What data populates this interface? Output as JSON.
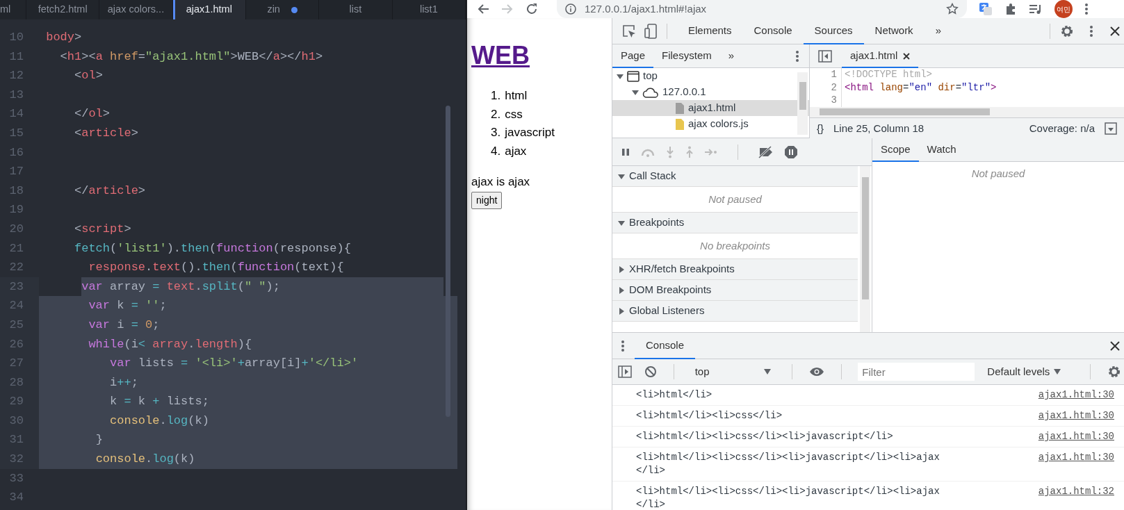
{
  "editor": {
    "tabs": [
      {
        "label": "ml",
        "selected": false,
        "modified": false
      },
      {
        "label": "fetch2.html",
        "selected": false,
        "modified": false
      },
      {
        "label": "ajax colors...",
        "selected": false,
        "modified": false
      },
      {
        "label": "ajax1.html",
        "selected": true,
        "modified": false
      },
      {
        "label": "zin",
        "selected": false,
        "modified": true
      },
      {
        "label": "list",
        "selected": false,
        "modified": false
      },
      {
        "label": "list1",
        "selected": false,
        "modified": false
      }
    ],
    "lines": [
      {
        "number": "10",
        "selected": false,
        "tokens": [
          {
            "text": " body",
            "kind": "tag"
          },
          {
            "text": ">",
            "kind": "plain"
          }
        ]
      },
      {
        "number": "11",
        "selected": false,
        "tokens": [
          {
            "text": "   <",
            "kind": "plain"
          },
          {
            "text": "h1",
            "kind": "tag"
          },
          {
            "text": "><",
            "kind": "plain"
          },
          {
            "text": "a",
            "kind": "tag"
          },
          {
            "text": " href",
            "kind": "attr"
          },
          {
            "text": "=",
            "kind": "plain"
          },
          {
            "text": "\"ajax1.html\"",
            "kind": "str"
          },
          {
            "text": ">WEB</",
            "kind": "plain"
          },
          {
            "text": "a",
            "kind": "tag"
          },
          {
            "text": "></",
            "kind": "plain"
          },
          {
            "text": "h1",
            "kind": "tag"
          },
          {
            "text": ">",
            "kind": "plain"
          }
        ]
      },
      {
        "number": "12",
        "selected": false,
        "tokens": [
          {
            "text": "     <",
            "kind": "plain"
          },
          {
            "text": "ol",
            "kind": "tag"
          },
          {
            "text": ">",
            "kind": "plain"
          }
        ]
      },
      {
        "number": "13",
        "selected": false
      },
      {
        "number": "14",
        "selected": false,
        "tokens": [
          {
            "text": "     </",
            "kind": "plain"
          },
          {
            "text": "ol",
            "kind": "tag"
          },
          {
            "text": ">",
            "kind": "plain"
          }
        ]
      },
      {
        "number": "15",
        "selected": false,
        "tokens": [
          {
            "text": "     <",
            "kind": "plain"
          },
          {
            "text": "article",
            "kind": "tag"
          },
          {
            "text": ">",
            "kind": "plain"
          }
        ]
      },
      {
        "number": "16",
        "selected": false
      },
      {
        "number": "17",
        "selected": false
      },
      {
        "number": "18",
        "selected": false,
        "tokens": [
          {
            "text": "     </",
            "kind": "plain"
          },
          {
            "text": "article",
            "kind": "tag"
          },
          {
            "text": ">",
            "kind": "plain"
          }
        ]
      },
      {
        "number": "19",
        "selected": false
      },
      {
        "number": "20",
        "selected": false,
        "tokens": [
          {
            "text": "     <",
            "kind": "plain"
          },
          {
            "text": "script",
            "kind": "tag"
          },
          {
            "text": ">",
            "kind": "plain"
          }
        ]
      },
      {
        "number": "21",
        "selected": false,
        "tokens": [
          {
            "text": "     fetch",
            "kind": "fn"
          },
          {
            "text": "(",
            "kind": "plain"
          },
          {
            "text": "'list1'",
            "kind": "str"
          },
          {
            "text": ").",
            "kind": "plain"
          },
          {
            "text": "then",
            "kind": "fn"
          },
          {
            "text": "(",
            "kind": "plain"
          },
          {
            "text": "function",
            "kind": "kw"
          },
          {
            "text": "(response){",
            "kind": "plain"
          }
        ]
      },
      {
        "number": "22",
        "selected": false,
        "tokens": [
          {
            "text": "       response",
            "kind": "var"
          },
          {
            "text": ".",
            "kind": "plain"
          },
          {
            "text": "text",
            "kind": "var"
          },
          {
            "text": "().",
            "kind": "plain"
          },
          {
            "text": "then",
            "kind": "fn"
          },
          {
            "text": "(",
            "kind": "plain"
          },
          {
            "text": "function",
            "kind": "kw"
          },
          {
            "text": "(text){",
            "kind": "plain"
          }
        ]
      },
      {
        "number": "23",
        "selected": true,
        "selection_from_text": true,
        "tokens": [
          {
            "text": "      var",
            "kind": "kw"
          },
          {
            "text": " array ",
            "kind": "plain"
          },
          {
            "text": "=",
            "kind": "op"
          },
          {
            "text": " text",
            "kind": "var"
          },
          {
            "text": ".",
            "kind": "plain"
          },
          {
            "text": "split",
            "kind": "fn"
          },
          {
            "text": "(",
            "kind": "plain"
          },
          {
            "text": "\" \"",
            "kind": "str"
          },
          {
            "text": ");",
            "kind": "plain"
          }
        ]
      },
      {
        "number": "24",
        "selected": true,
        "tokens": [
          {
            "text": "       var",
            "kind": "kw"
          },
          {
            "text": " k ",
            "kind": "plain"
          },
          {
            "text": "=",
            "kind": "op"
          },
          {
            "text": " ''",
            "kind": "str"
          },
          {
            "text": ";",
            "kind": "plain"
          }
        ]
      },
      {
        "number": "25",
        "selected": true,
        "tokens": [
          {
            "text": "       var",
            "kind": "kw"
          },
          {
            "text": " i ",
            "kind": "plain"
          },
          {
            "text": "=",
            "kind": "op"
          },
          {
            "text": " 0",
            "kind": "num"
          },
          {
            "text": ";",
            "kind": "plain"
          }
        ]
      },
      {
        "number": "26",
        "selected": true,
        "tokens": [
          {
            "text": "       while",
            "kind": "kw"
          },
          {
            "text": "(i",
            "kind": "plain"
          },
          {
            "text": "<",
            "kind": "op"
          },
          {
            "text": " array",
            "kind": "var"
          },
          {
            "text": ".",
            "kind": "plain"
          },
          {
            "text": "length",
            "kind": "var"
          },
          {
            "text": "){",
            "kind": "plain"
          }
        ]
      },
      {
        "number": "27",
        "selected": true,
        "tokens": [
          {
            "text": "          var",
            "kind": "kw"
          },
          {
            "text": " lists ",
            "kind": "plain"
          },
          {
            "text": "=",
            "kind": "op"
          },
          {
            "text": " '<li>'",
            "kind": "str"
          },
          {
            "text": "+",
            "kind": "op"
          },
          {
            "text": "array[i]",
            "kind": "plain"
          },
          {
            "text": "+",
            "kind": "op"
          },
          {
            "text": "'</li>'",
            "kind": "str"
          }
        ]
      },
      {
        "number": "28",
        "selected": true,
        "tokens": [
          {
            "text": "          i",
            "kind": "plain"
          },
          {
            "text": "++",
            "kind": "op"
          },
          {
            "text": ";",
            "kind": "plain"
          }
        ]
      },
      {
        "number": "29",
        "selected": true,
        "tokens": [
          {
            "text": "          k ",
            "kind": "plain"
          },
          {
            "text": "=",
            "kind": "op"
          },
          {
            "text": " k ",
            "kind": "plain"
          },
          {
            "text": "+",
            "kind": "op"
          },
          {
            "text": " lists;",
            "kind": "plain"
          }
        ]
      },
      {
        "number": "30",
        "selected": true,
        "tokens": [
          {
            "text": "          console",
            "kind": "obj"
          },
          {
            "text": ".",
            "kind": "plain"
          },
          {
            "text": "log",
            "kind": "fn"
          },
          {
            "text": "(k)",
            "kind": "plain"
          }
        ]
      },
      {
        "number": "31",
        "selected": true,
        "tokens": [
          {
            "text": "        }",
            "kind": "plain"
          }
        ]
      },
      {
        "number": "32",
        "selected": true,
        "tokens": [
          {
            "text": "        console",
            "kind": "obj"
          },
          {
            "text": ".",
            "kind": "plain"
          },
          {
            "text": "log",
            "kind": "fn"
          },
          {
            "text": "(k)",
            "kind": "plain"
          }
        ]
      },
      {
        "number": "33",
        "selected": false
      },
      {
        "number": "34",
        "selected": false
      }
    ]
  },
  "browser": {
    "url": "127.0.0.1/ajax1.html#!ajax",
    "profile": "여민",
    "page": {
      "heading": "WEB",
      "list": [
        {
          "number": "1.",
          "label": "html"
        },
        {
          "number": "2.",
          "label": "css"
        },
        {
          "number": "3.",
          "label": "javascript"
        },
        {
          "number": "4.",
          "label": "ajax"
        }
      ],
      "paragraph": "ajax is ajax",
      "button": "night"
    }
  },
  "devtools": {
    "tabs": [
      {
        "label": "Elements",
        "selected": false
      },
      {
        "label": "Console",
        "selected": false
      },
      {
        "label": "Sources",
        "selected": true
      },
      {
        "label": "Network",
        "selected": false
      }
    ],
    "more": "»",
    "navigator": {
      "tabs": [
        {
          "label": "Page",
          "selected": true
        },
        {
          "label": "Filesystem",
          "selected": false
        }
      ],
      "more": "»",
      "tree": [
        {
          "label": "top",
          "kind": "frame",
          "expanded": true,
          "children": [
            {
              "label": "127.0.0.1",
              "kind": "domain",
              "expanded": true,
              "children": [
                {
                  "label": "ajax1.html",
                  "kind": "html",
                  "selected": true
                },
                {
                  "label": "ajax colors.js",
                  "kind": "js",
                  "selected": false
                }
              ]
            }
          ]
        }
      ]
    },
    "source": {
      "tabs": [
        {
          "label": "ajax1.html",
          "selected": true
        }
      ],
      "lines": [
        {
          "number": "1",
          "tokens": [
            {
              "text": "<!DOCTYPE html>",
              "kind": "dt"
            }
          ]
        },
        {
          "number": "2",
          "tokens": [
            {
              "text": "<html",
              "kind": "stag"
            },
            {
              "text": " lang",
              "kind": "sattr"
            },
            {
              "text": "=",
              "kind": "sp"
            },
            {
              "text": "\"en\"",
              "kind": "sval"
            },
            {
              "text": " dir",
              "kind": "sattr"
            },
            {
              "text": "=",
              "kind": "sp"
            },
            {
              "text": "\"ltr\"",
              "kind": "sval"
            },
            {
              "text": ">",
              "kind": "stag"
            }
          ]
        },
        {
          "number": "3"
        }
      ],
      "format": "{}",
      "status": "Line 25, Column 18",
      "coverage": "Coverage: n/a"
    },
    "debugger": {
      "sections": [
        {
          "title": "Call Stack",
          "expanded": true,
          "message": "Not paused"
        },
        {
          "title": "Breakpoints",
          "expanded": true,
          "message": "No breakpoints"
        },
        {
          "title": "XHR/fetch Breakpoints",
          "expanded": false
        },
        {
          "title": "DOM Breakpoints",
          "expanded": false
        },
        {
          "title": "Global Listeners",
          "expanded": false
        }
      ],
      "side_tabs": [
        {
          "label": "Scope",
          "selected": true
        },
        {
          "label": "Watch",
          "selected": false
        }
      ],
      "side_message": "Not paused"
    },
    "console": {
      "drawer_tabs": [
        {
          "label": "Console",
          "selected": true
        }
      ],
      "context": "top",
      "filter": {
        "placeholder": "Filter"
      },
      "levels": "Default levels",
      "messages": [
        {
          "text": "<li>html</li>",
          "source": "ajax1.html:30"
        },
        {
          "text": "<li>html</li><li>css</li>",
          "source": "ajax1.html:30"
        },
        {
          "text": "<li>html</li><li>css</li><li>javascript</li>",
          "source": "ajax1.html:30"
        },
        {
          "text": "<li>html</li><li>css</li><li>javascript</li><li>ajax</li>",
          "source": "ajax1.html:30"
        },
        {
          "text": "<li>html</li><li>css</li><li>javascript</li><li>ajax</li>",
          "source": "ajax1.html:32"
        }
      ]
    }
  }
}
